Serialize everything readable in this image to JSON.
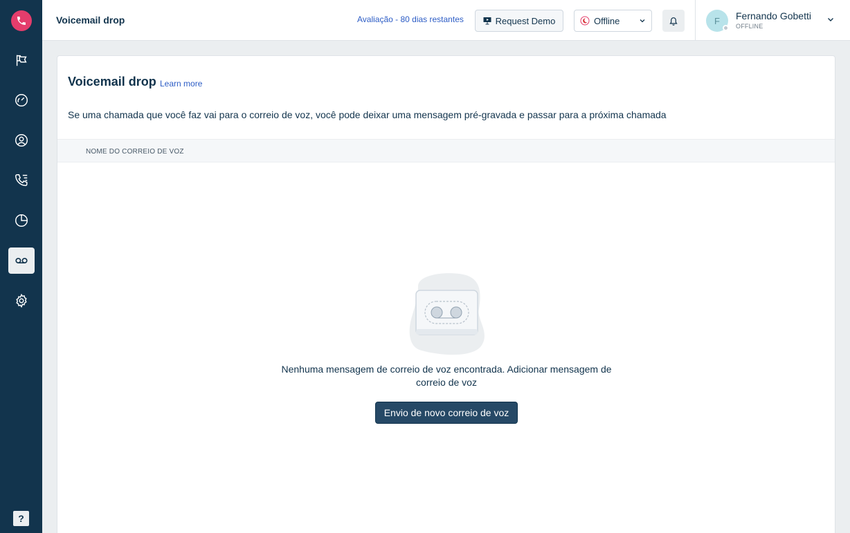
{
  "header": {
    "page_title": "Voicemail drop",
    "trial_text": "Avaliação - 80 dias restantes",
    "request_demo_label": "Request Demo",
    "status_value": "Offline",
    "user": {
      "initial": "F",
      "name": "Fernando Gobetti",
      "status": "OFFLINE"
    }
  },
  "sidebar": {
    "items": [
      {
        "icon": "flag-icon"
      },
      {
        "icon": "dashboard-icon"
      },
      {
        "icon": "contacts-icon"
      },
      {
        "icon": "call-log-icon"
      },
      {
        "icon": "analytics-icon"
      },
      {
        "icon": "voicemail-icon",
        "active": true
      },
      {
        "icon": "settings-icon"
      }
    ],
    "help_label": "?"
  },
  "main": {
    "title": "Voicemail drop",
    "learn_more": "Learn more",
    "description": "Se uma chamada que você faz vai para o correio de voz, você pode deixar uma mensagem pré-gravada e passar para a próxima chamada",
    "table": {
      "columns": [
        "NOME DO CORREIO DE VOZ"
      ]
    },
    "empty_state": {
      "message": "Nenhuma mensagem de correio de voz encontrada. Adicionar mensagem de correio de voz",
      "button_label": "Envio de novo correio de voz"
    }
  },
  "colors": {
    "sidebar_bg": "#12344d",
    "brand_pink": "#e43d6c",
    "link_blue": "#2c5cc5",
    "primary_button": "#264966"
  }
}
